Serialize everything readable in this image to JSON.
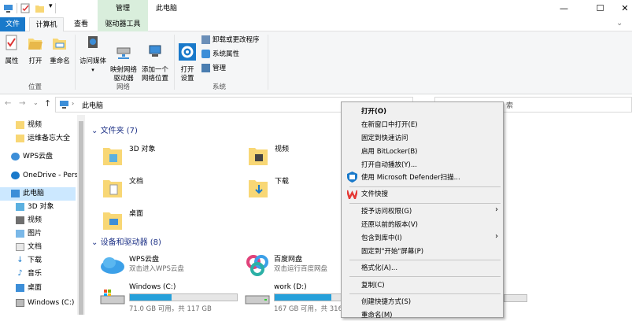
{
  "window": {
    "ribbon_context_label": "管理",
    "title": "此电脑",
    "minimize": "—",
    "maximize": "☐",
    "close": "✕"
  },
  "tabs": {
    "file": "文件",
    "computer": "计算机",
    "view": "查看",
    "drive_tools": "驱动器工具"
  },
  "ribbon": {
    "location": {
      "label": "位置",
      "properties": "属性",
      "open": "打开",
      "rename": "重命名"
    },
    "network": {
      "label": "网络",
      "access_media": "访问媒体",
      "map_drive": "映射网络\n驱动器",
      "add_location": "添加一个\n网络位置"
    },
    "system": {
      "label": "系统",
      "open_settings": "打开\n设置",
      "uninstall": "卸载或更改程序",
      "sys_props": "系统属性",
      "manage": "管理"
    }
  },
  "address": {
    "path": "此电脑",
    "search_text": "索"
  },
  "sidebar": {
    "items": [
      {
        "label": "视频"
      },
      {
        "label": "运维备忘大全"
      },
      {
        "label": "WPS云盘"
      },
      {
        "label": "OneDrive - Perso"
      },
      {
        "label": "此电脑"
      },
      {
        "label": "3D 对象"
      },
      {
        "label": "视频"
      },
      {
        "label": "图片"
      },
      {
        "label": "文档"
      },
      {
        "label": "下载"
      },
      {
        "label": "音乐"
      },
      {
        "label": "桌面"
      },
      {
        "label": "Windows (C:)"
      }
    ]
  },
  "main": {
    "folders_header": "文件夹 (7)",
    "folders": [
      {
        "label": "3D 对象"
      },
      {
        "label": "视频"
      },
      {
        "label": "文档"
      },
      {
        "label": "下载"
      },
      {
        "label": "桌面"
      }
    ],
    "devices_header": "设备和驱动器 (8)",
    "devices": [
      {
        "name": "WPS云盘",
        "sub": "双击进入WPS云盘"
      },
      {
        "name": "百度网盘",
        "sub": "双击运行百度网盘"
      },
      {
        "name": "Windows (C:)",
        "sub": "71.0 GB 可用，共 117 GB",
        "used_fraction": 0.39
      },
      {
        "name": "work (D:)",
        "sub": "167 GB 可用，共 316",
        "used_fraction": 0.47
      }
    ]
  },
  "context_menu": {
    "items": [
      {
        "label": "打开(O)"
      },
      {
        "label": "在新窗口中打开(E)"
      },
      {
        "label": "固定到快速访问"
      },
      {
        "label": "启用 BitLocker(B)"
      },
      {
        "label": "打开自动播放(Y)..."
      },
      {
        "label": "使用 Microsoft Defender扫描..."
      },
      {
        "label": "文件快搜"
      },
      {
        "label": "授予访问权限(G)"
      },
      {
        "label": "还原以前的版本(V)"
      },
      {
        "label": "包含到库中(I)"
      },
      {
        "label": "固定到\"开始\"屏幕(P)"
      },
      {
        "label": "格式化(A)..."
      },
      {
        "label": "复制(C)"
      },
      {
        "label": "创建快捷方式(S)"
      },
      {
        "label": "重命名(M)"
      }
    ]
  },
  "colors": {
    "accent": "#1979ca",
    "manage_tab": "#d9eedc",
    "selection": "#cce8ff",
    "drive_fill": "#26a0da",
    "folder_yellow": "#f8d775"
  }
}
